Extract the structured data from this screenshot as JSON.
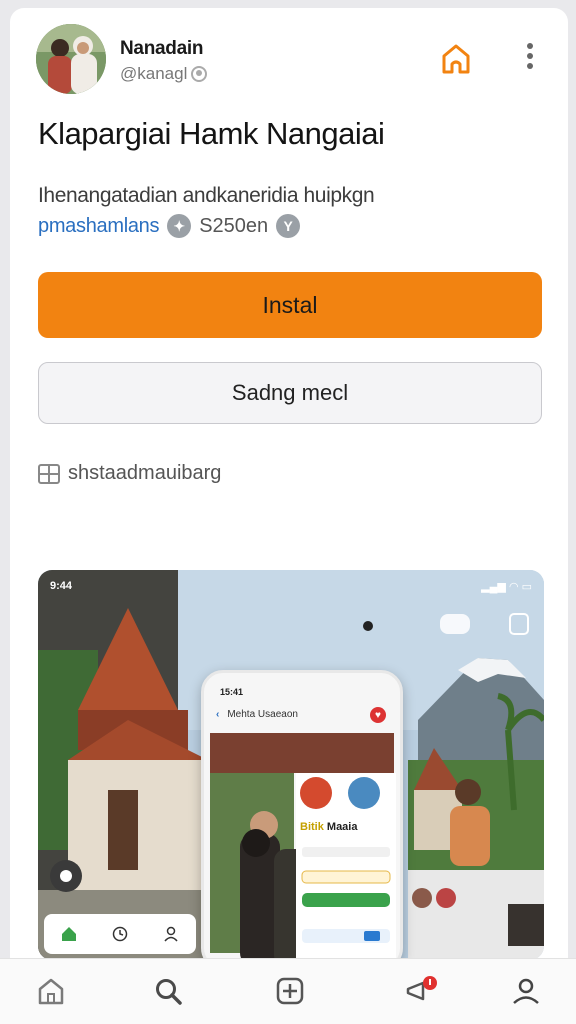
{
  "header": {
    "developer_name": "Nanadain",
    "developer_handle": "@kanagl"
  },
  "app": {
    "title": "Klapargiai Hamk Nangaiai",
    "tagline": "Ihenangatadian andkaneridia huipkgn",
    "category": "pmashamlans",
    "size": "S250en"
  },
  "buttons": {
    "install_label": "Instal",
    "secondary_label": "Sadng mecl"
  },
  "info": {
    "label": "shstaadmauibarg"
  },
  "preview": {
    "status_time": "9:44",
    "phone_time": "15:41",
    "phone_header": "Mehta Usaeaon",
    "card_title_accent": "Bitik",
    "card_title": "Maaia"
  },
  "colors": {
    "accent": "#f28311",
    "link": "#2a6fc0",
    "notification": "#e0312f"
  },
  "icons": {
    "bookmark": "house-bookmark-icon",
    "more": "more-vertical-icon",
    "home": "home-icon",
    "search": "search-icon",
    "add": "add-icon",
    "notifications": "notification-bell-icon",
    "profile": "profile-icon"
  }
}
